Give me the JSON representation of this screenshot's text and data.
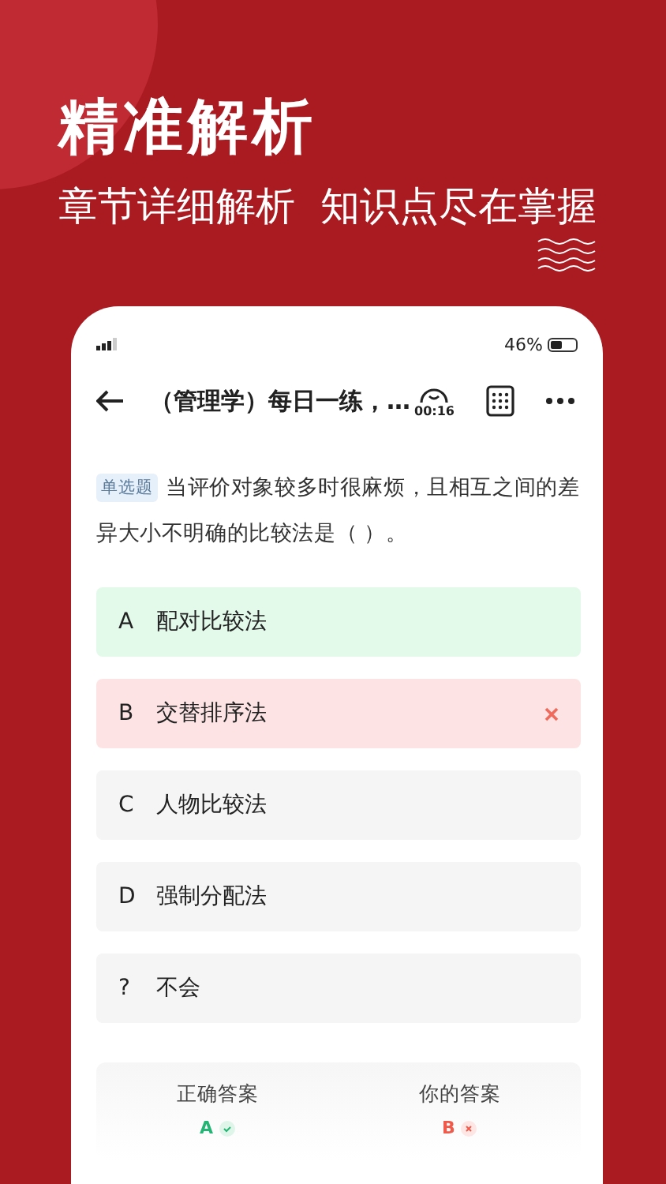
{
  "banner": {
    "title": "精准解析",
    "subtitle": "章节详细解析  知识点尽在掌握"
  },
  "status_bar": {
    "battery_text": "46%"
  },
  "nav": {
    "title": "（管理学）每日一练，…",
    "timer": "00:16"
  },
  "question": {
    "type_tag": "单选题",
    "lines": [
      "当评价对象较多时很麻烦，且相互之间的差",
      "异大小不明确的比较法是（ ）。"
    ]
  },
  "options": [
    {
      "letter": "A",
      "text": "配对比较法",
      "kind": "correct"
    },
    {
      "letter": "B",
      "text": "交替排序法",
      "kind": "wrong"
    },
    {
      "letter": "C",
      "text": "人物比较法",
      "kind": "plain"
    },
    {
      "letter": "D",
      "text": "强制分配法",
      "kind": "plain"
    },
    {
      "letter": "?",
      "text": "不会",
      "kind": "plain"
    }
  ],
  "answers": [
    {
      "label": "正确答案",
      "letter": "A",
      "kind": "correct"
    },
    {
      "label": "你的答案",
      "letter": "B",
      "kind": "wrong"
    }
  ]
}
